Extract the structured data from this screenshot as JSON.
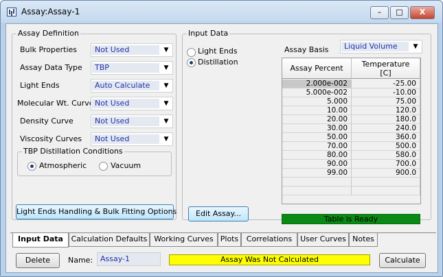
{
  "window": {
    "title": "Assay:Assay-1",
    "minimize": "–",
    "maximize": "□",
    "close": "X"
  },
  "assay_definition": {
    "legend": "Assay Definition",
    "fields": [
      {
        "label": "Bulk Properties",
        "value": "Not Used"
      },
      {
        "label": "Assay Data Type",
        "value": "TBP"
      },
      {
        "label": "Light Ends",
        "value": "Auto Calculate"
      },
      {
        "label": "Molecular Wt. Curve",
        "value": "Not Used"
      },
      {
        "label": "Density Curve",
        "value": "Not Used"
      },
      {
        "label": "Viscosity Curves",
        "value": "Not Used"
      }
    ],
    "tbp": {
      "legend": "TBP Distillation Conditions",
      "options": [
        "Atmospheric",
        "Vacuum"
      ],
      "selected": "Atmospheric"
    },
    "options_button": "Light Ends Handling & Bulk Fitting Options"
  },
  "input_data": {
    "legend": "Input Data",
    "radios": [
      "Light Ends",
      "Distillation"
    ],
    "selected": "Distillation",
    "assay_basis_label": "Assay Basis",
    "assay_basis_value": "Liquid Volume",
    "edit_button": "Edit Assay...",
    "table": {
      "headers": [
        "Assay Percent",
        "Temperature",
        "[C]"
      ],
      "rows": [
        [
          "2.000e-002",
          "-25.00"
        ],
        [
          "5.000e-002",
          "-10.00"
        ],
        [
          "5.000",
          "75.00"
        ],
        [
          "10.00",
          "120.0"
        ],
        [
          "20.00",
          "180.0"
        ],
        [
          "30.00",
          "240.0"
        ],
        [
          "50.00",
          "360.0"
        ],
        [
          "70.00",
          "500.0"
        ],
        [
          "80.00",
          "580.0"
        ],
        [
          "90.00",
          "700.0"
        ],
        [
          "99.00",
          "900.0"
        ],
        [
          "",
          ""
        ],
        [
          "",
          ""
        ]
      ]
    },
    "status": "Table is Ready"
  },
  "tabs": [
    "Input Data",
    "Calculation Defaults",
    "Working Curves",
    "Plots",
    "Correlations",
    "User Curves",
    "Notes"
  ],
  "active_tab": "Input Data",
  "bottom": {
    "delete_button": "Delete",
    "name_label": "Name:",
    "name_value": "Assay-1",
    "message": "Assay Was Not Calculated",
    "calculate_button": "Calculate"
  }
}
